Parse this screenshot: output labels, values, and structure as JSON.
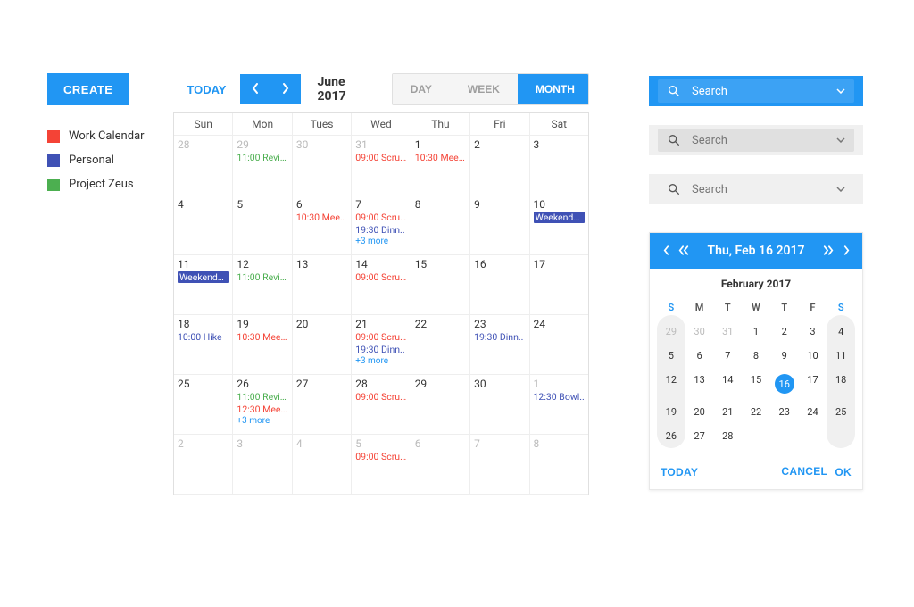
{
  "colors": {
    "primary": "#2196f3",
    "work": "#f44336",
    "personal": "#3f51b5",
    "zeus": "#4caf50"
  },
  "toolbar": {
    "create_label": "CREATE",
    "today_label": "TODAY",
    "month_label": "June 2017",
    "view_day": "DAY",
    "view_week": "WEEK",
    "view_month": "MONTH"
  },
  "legend": [
    {
      "label": "Work Calendar",
      "color": "#f44336"
    },
    {
      "label": "Personal",
      "color": "#3f51b5"
    },
    {
      "label": "Project Zeus",
      "color": "#4caf50"
    }
  ],
  "weekday_headers": [
    "Sun",
    "Mon",
    "Tues",
    "Wed",
    "Thu",
    "Fri",
    "Sat"
  ],
  "weeks": [
    [
      {
        "n": "28",
        "out": true
      },
      {
        "n": "29",
        "out": true,
        "events": [
          {
            "t": "11:00 Revie..",
            "c": "zeus"
          }
        ]
      },
      {
        "n": "30",
        "out": true
      },
      {
        "n": "31",
        "out": true,
        "events": [
          {
            "t": "09:00 Scrum",
            "c": "work"
          }
        ]
      },
      {
        "n": "1",
        "events": [
          {
            "t": "10:30 Meet..",
            "c": "work"
          }
        ]
      },
      {
        "n": "2"
      },
      {
        "n": "3"
      }
    ],
    [
      {
        "n": "4"
      },
      {
        "n": "5"
      },
      {
        "n": "6",
        "events": [
          {
            "t": "10:30 Meet..",
            "c": "work"
          }
        ]
      },
      {
        "n": "7",
        "events": [
          {
            "t": "09:00 Scrum",
            "c": "work"
          },
          {
            "t": "19:30 Dinn..",
            "c": "personal"
          }
        ],
        "more": "+3 more"
      },
      {
        "n": "8"
      },
      {
        "n": "9"
      },
      {
        "n": "10",
        "events": [
          {
            "t": "Weekend…",
            "c": "chip-personal"
          }
        ]
      }
    ],
    [
      {
        "n": "11",
        "events": [
          {
            "t": "Weekend…",
            "c": "chip-personal"
          }
        ]
      },
      {
        "n": "12",
        "events": [
          {
            "t": "11:00 Revie..",
            "c": "zeus"
          }
        ]
      },
      {
        "n": "13"
      },
      {
        "n": "14",
        "events": [
          {
            "t": "09:00 Scrum",
            "c": "work"
          }
        ]
      },
      {
        "n": "15"
      },
      {
        "n": "16"
      },
      {
        "n": "17"
      }
    ],
    [
      {
        "n": "18",
        "events": [
          {
            "t": "10:00 Hike",
            "c": "personal"
          }
        ]
      },
      {
        "n": "19",
        "events": [
          {
            "t": "10:30 Meet..",
            "c": "work"
          }
        ]
      },
      {
        "n": "20"
      },
      {
        "n": "21",
        "events": [
          {
            "t": "09:00 Scrum",
            "c": "work"
          },
          {
            "t": "19:30 Dinn..",
            "c": "personal"
          }
        ],
        "more": "+3 more"
      },
      {
        "n": "22"
      },
      {
        "n": "23",
        "events": [
          {
            "t": "19:30 Dinn..",
            "c": "personal"
          }
        ]
      },
      {
        "n": "24"
      }
    ],
    [
      {
        "n": "25"
      },
      {
        "n": "26",
        "events": [
          {
            "t": "11:00 Revie..",
            "c": "zeus"
          },
          {
            "t": "12:30 Meet..",
            "c": "work"
          }
        ],
        "more": "+3 more"
      },
      {
        "n": "27"
      },
      {
        "n": "28",
        "events": [
          {
            "t": "09:00 Scrum",
            "c": "work"
          }
        ]
      },
      {
        "n": "29"
      },
      {
        "n": "30"
      },
      {
        "n": "1",
        "out": true,
        "events": [
          {
            "t": "12:30 Bowl..",
            "c": "personal"
          }
        ]
      }
    ],
    [
      {
        "n": "2",
        "out": true
      },
      {
        "n": "3",
        "out": true
      },
      {
        "n": "4",
        "out": true
      },
      {
        "n": "5",
        "out": true,
        "events": [
          {
            "t": "09:00 Scrum",
            "c": "work"
          }
        ]
      },
      {
        "n": "6",
        "out": true
      },
      {
        "n": "7",
        "out": true
      },
      {
        "n": "8",
        "out": true
      }
    ]
  ],
  "search": {
    "placeholder": "Search"
  },
  "datepicker": {
    "header": "Thu, Feb 16 2017",
    "subheader": "February 2017",
    "day_headers": [
      "S",
      "M",
      "T",
      "W",
      "T",
      "F",
      "S"
    ],
    "rows": [
      [
        {
          "n": "29",
          "out": true
        },
        {
          "n": "30",
          "out": true
        },
        {
          "n": "31",
          "out": true
        },
        {
          "n": "1"
        },
        {
          "n": "2"
        },
        {
          "n": "3"
        },
        {
          "n": "4"
        }
      ],
      [
        {
          "n": "5"
        },
        {
          "n": "6"
        },
        {
          "n": "7"
        },
        {
          "n": "8"
        },
        {
          "n": "9"
        },
        {
          "n": "10"
        },
        {
          "n": "11"
        }
      ],
      [
        {
          "n": "12"
        },
        {
          "n": "13"
        },
        {
          "n": "14"
        },
        {
          "n": "15"
        },
        {
          "n": "16",
          "selected": true
        },
        {
          "n": "17"
        },
        {
          "n": "18"
        }
      ],
      [
        {
          "n": "19"
        },
        {
          "n": "20"
        },
        {
          "n": "21"
        },
        {
          "n": "22"
        },
        {
          "n": "23"
        },
        {
          "n": "24"
        },
        {
          "n": "25"
        }
      ],
      [
        {
          "n": "26"
        },
        {
          "n": "27"
        },
        {
          "n": "28"
        },
        {
          "n": ""
        },
        {
          "n": ""
        },
        {
          "n": ""
        },
        {
          "n": ""
        }
      ]
    ],
    "today_label": "TODAY",
    "cancel_label": "CANCEL",
    "ok_label": "OK"
  }
}
